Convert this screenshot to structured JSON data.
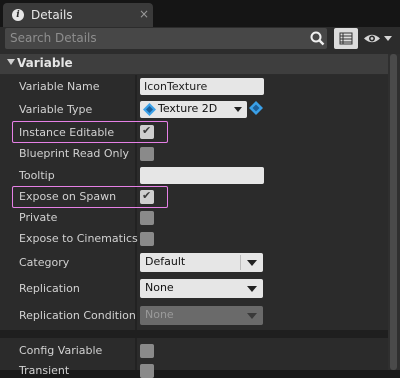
{
  "tab": {
    "title": "Details",
    "close": "×",
    "icon": "info-icon"
  },
  "search": {
    "placeholder": "Search Details"
  },
  "category": {
    "label": "Variable"
  },
  "rows": {
    "variable_name": {
      "label": "Variable Name",
      "value": "IconTexture"
    },
    "variable_type": {
      "label": "Variable Type",
      "value": "Texture 2D"
    },
    "instance_editable": {
      "label": "Instance Editable",
      "checked": true
    },
    "blueprint_read_only": {
      "label": "Blueprint Read Only",
      "checked": false
    },
    "tooltip": {
      "label": "Tooltip",
      "value": ""
    },
    "expose_on_spawn": {
      "label": "Expose on Spawn",
      "checked": true
    },
    "private": {
      "label": "Private",
      "checked": false
    },
    "expose_to_cinematics": {
      "label": "Expose to Cinematics",
      "checked": false
    },
    "category_field": {
      "label": "Category",
      "value": "Default"
    },
    "replication": {
      "label": "Replication",
      "value": "None"
    },
    "replication_condition": {
      "label": "Replication Condition",
      "value": "None"
    },
    "config_variable": {
      "label": "Config Variable",
      "checked": false
    },
    "transient": {
      "label": "Transient",
      "checked": false
    }
  },
  "colors": {
    "highlight": "#e680e6",
    "accent_blue": "#3aa0e8"
  }
}
